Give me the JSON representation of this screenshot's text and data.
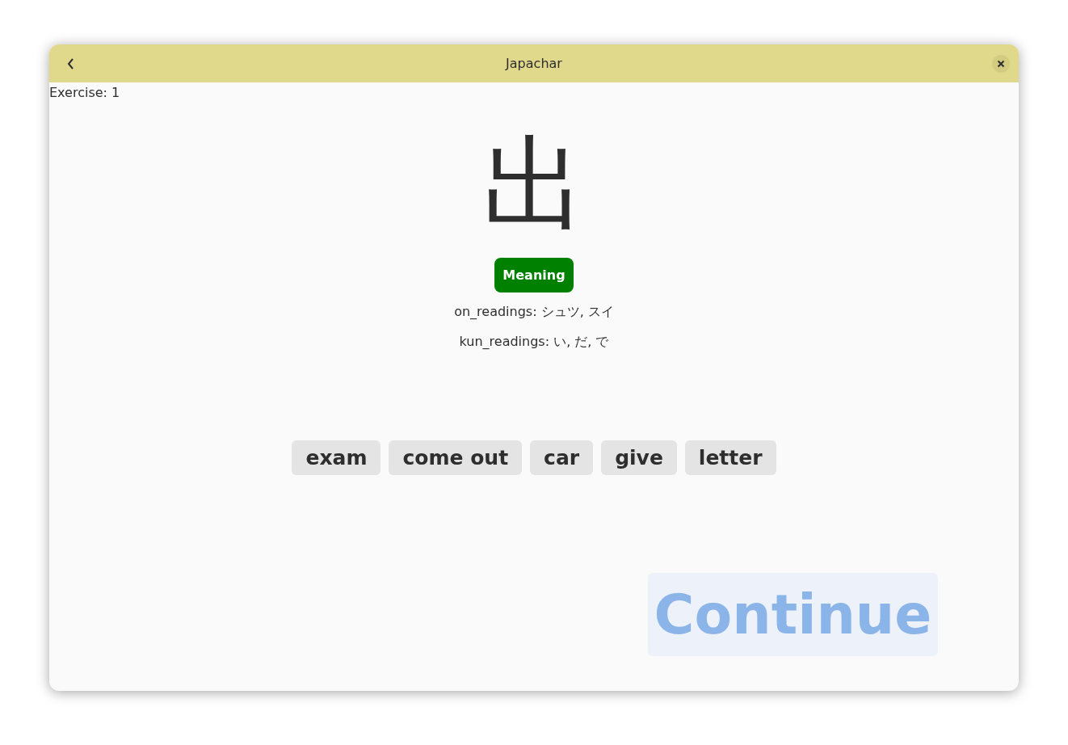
{
  "window": {
    "title": "Japachar"
  },
  "exercise": "Exercise: 1",
  "kanji": "出",
  "meaning_button": "Meaning",
  "on_readings": "on_readings: シュツ, スイ",
  "kun_readings": "kun_readings: い, だ, で",
  "options": [
    "exam",
    "come out",
    "car",
    "give",
    "letter"
  ],
  "continue_button": {
    "label": "Continue",
    "disabled": true
  }
}
